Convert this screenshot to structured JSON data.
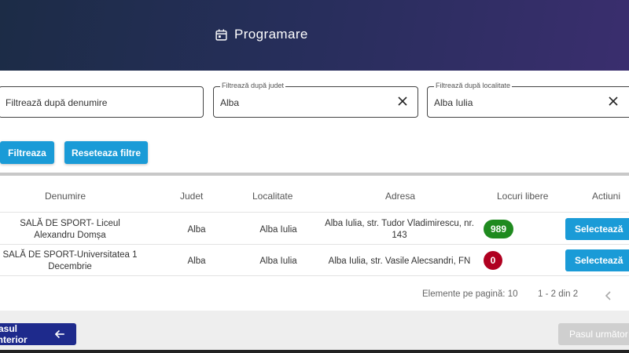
{
  "header": {
    "title": "Programare",
    "icon": "calendar-icon"
  },
  "filters": {
    "name_placeholder": "Filtrează după denumire",
    "judet_label": "Filtrează după judet",
    "judet_value": "Alba",
    "localitate_label": "Filtrează după localitate",
    "localitate_value": "Alba Iulia",
    "filter_button": "Filtreaza",
    "reset_button": "Reseteaza filtre"
  },
  "table": {
    "columns": [
      "Denumire",
      "Judet",
      "Localitate",
      "Adresa",
      "Locuri libere",
      "Actiuni"
    ],
    "rows": [
      {
        "denumire": "SALĂ DE SPORT- Liceul Alexandru Domșa",
        "judet": "Alba",
        "localitate": "Alba Iulia",
        "adresa": "Alba Iulia, str. Tudor Vladimirescu, nr. 143",
        "locuri": "989",
        "action": "Selectează"
      },
      {
        "denumire": "SALĂ DE SPORT-Universitatea 1 Decembrie",
        "judet": "Alba",
        "localitate": "Alba Iulia",
        "adresa": "Alba Iulia, str. Vasile Alecsandri, FN",
        "locuri": "0",
        "action": "Selectează"
      }
    ],
    "pagination": {
      "per_page_label": "Elemente pe pagină: 10",
      "range": "1 - 2 din 2"
    }
  },
  "navigation": {
    "prev": "Pasul anterior",
    "next": "Pasul următor"
  },
  "colors": {
    "available": "#1f8a1f",
    "full": "#b00020",
    "primary": "#1a9bd7",
    "nav": "#1e2a8c"
  }
}
